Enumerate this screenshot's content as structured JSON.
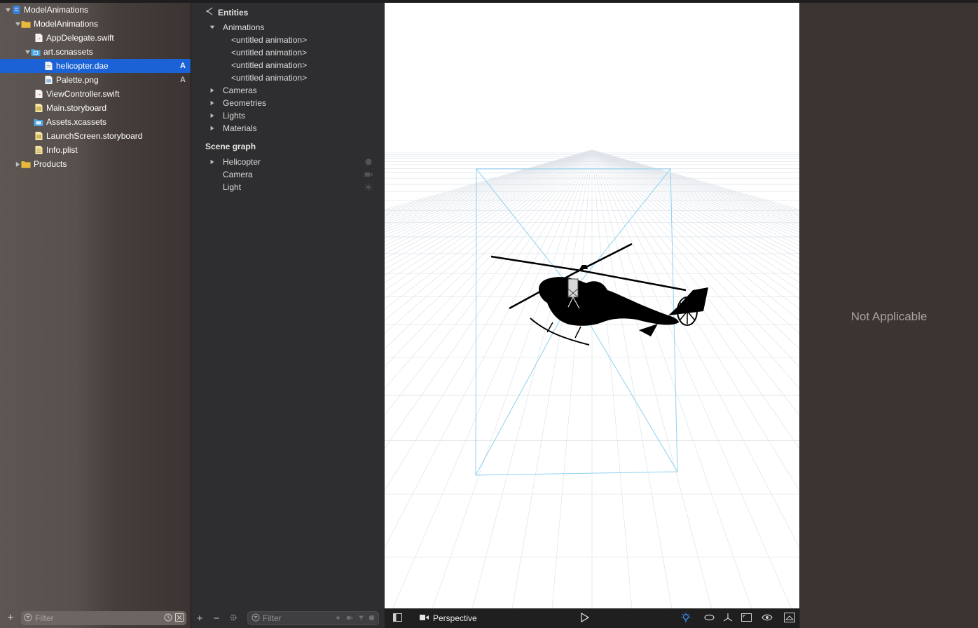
{
  "navigator": {
    "items": [
      {
        "label": "ModelAnimations",
        "badge": ""
      },
      {
        "label": "ModelAnimations",
        "badge": ""
      },
      {
        "label": "AppDelegate.swift",
        "badge": ""
      },
      {
        "label": "art.scnassets",
        "badge": ""
      },
      {
        "label": "helicopter.dae",
        "badge": "A"
      },
      {
        "label": "Palette.png",
        "badge": "A"
      },
      {
        "label": "ViewController.swift",
        "badge": ""
      },
      {
        "label": "Main.storyboard",
        "badge": ""
      },
      {
        "label": "Assets.xcassets",
        "badge": ""
      },
      {
        "label": "LaunchScreen.storyboard",
        "badge": ""
      },
      {
        "label": "Info.plist",
        "badge": ""
      },
      {
        "label": "Products",
        "badge": ""
      }
    ],
    "filter_placeholder": "Filter"
  },
  "outline": {
    "entities_title": "Entities",
    "animations_label": "Animations",
    "animations": [
      "<untitled animation>",
      "<untitled animation>",
      "<untitled animation>",
      "<untitled animation>"
    ],
    "groups": [
      "Cameras",
      "Geometries",
      "Lights",
      "Materials"
    ],
    "scene_graph_title": "Scene graph",
    "nodes": [
      "Helicopter",
      "Camera",
      "Light"
    ],
    "filter_placeholder": "Filter"
  },
  "viewport": {
    "camera_label": "Perspective"
  },
  "inspector": {
    "message": "Not Applicable"
  },
  "colors": {
    "selection": "#1b62d6",
    "folder": "#e8b93a",
    "camera_frustum": "#8fd0f0"
  }
}
